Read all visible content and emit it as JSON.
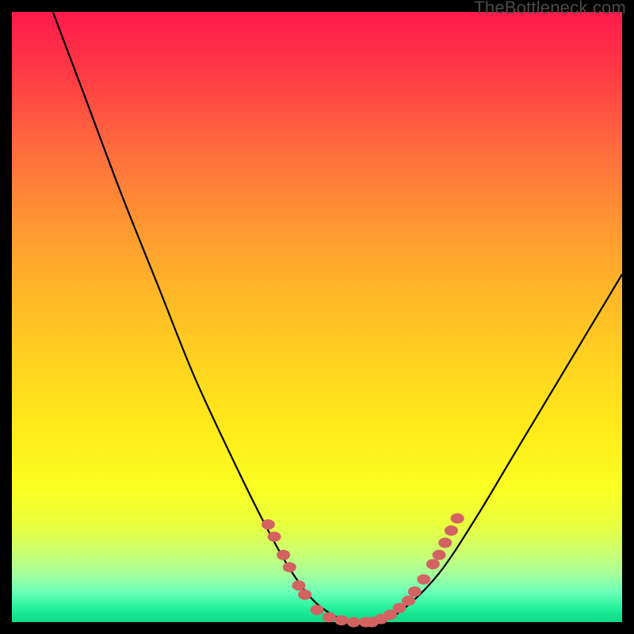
{
  "watermark": "TheBottleneck.com",
  "colors": {
    "top": "#ff1a4b",
    "mid": "#ffd41f",
    "bottom": "#12dd8a",
    "curve": "#000000",
    "dot": "#d36262",
    "frame": "#000000"
  },
  "chart_data": {
    "type": "line",
    "title": "",
    "xlabel": "",
    "ylabel": "",
    "xlim": [
      0,
      100
    ],
    "ylim": [
      0,
      100
    ],
    "grid": false,
    "x": [
      0,
      6,
      12,
      18,
      24,
      30,
      37,
      42,
      46,
      50,
      55,
      58,
      60,
      64,
      70,
      76,
      82,
      88,
      94,
      100
    ],
    "values": [
      119,
      102,
      86,
      70,
      55,
      40,
      25,
      15,
      8,
      3,
      0,
      0,
      0,
      2,
      8,
      17,
      27,
      37,
      47,
      57
    ],
    "annotation_points": [
      {
        "x": 42,
        "y": 16
      },
      {
        "x": 43,
        "y": 14
      },
      {
        "x": 44.5,
        "y": 11
      },
      {
        "x": 45.5,
        "y": 9
      },
      {
        "x": 47,
        "y": 6
      },
      {
        "x": 48,
        "y": 4.5
      },
      {
        "x": 50,
        "y": 2
      },
      {
        "x": 52,
        "y": 0.8
      },
      {
        "x": 54,
        "y": 0.3
      },
      {
        "x": 56,
        "y": 0
      },
      {
        "x": 58,
        "y": 0
      },
      {
        "x": 59,
        "y": 0
      },
      {
        "x": 60.5,
        "y": 0.5
      },
      {
        "x": 62,
        "y": 1.2
      },
      {
        "x": 63.5,
        "y": 2.3
      },
      {
        "x": 65,
        "y": 3.5
      },
      {
        "x": 66,
        "y": 5
      },
      {
        "x": 67.5,
        "y": 7
      },
      {
        "x": 69,
        "y": 9.5
      },
      {
        "x": 70,
        "y": 11
      },
      {
        "x": 71,
        "y": 13
      },
      {
        "x": 72,
        "y": 15
      },
      {
        "x": 73,
        "y": 17
      }
    ]
  }
}
